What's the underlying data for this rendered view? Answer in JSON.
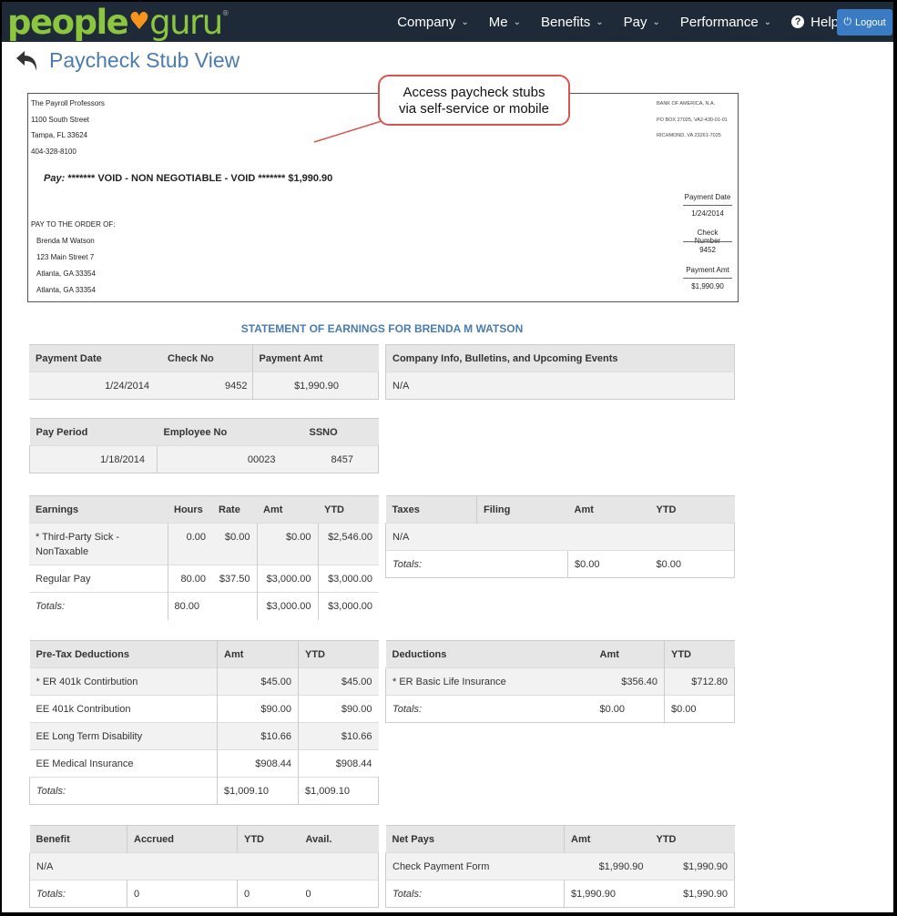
{
  "nav": {
    "logo_people": "people",
    "logo_guru": "guru",
    "items": [
      {
        "label": "Company",
        "chev": "⌄"
      },
      {
        "label": "Me",
        "chev": "⌄"
      },
      {
        "label": "Benefits",
        "chev": "⌄"
      },
      {
        "label": "Pay",
        "chev": "⌄"
      },
      {
        "label": "Performance",
        "chev": "⌄"
      }
    ],
    "help": "Help",
    "logout": "Logout"
  },
  "page": {
    "title": "Paycheck Stub View"
  },
  "callout": {
    "line1": "Access paycheck stubs",
    "line2": "via self-service or mobile"
  },
  "check": {
    "company": [
      "The Payroll Professors",
      "1100 South Street",
      "Tampa, FL 33624",
      "404-328-8100"
    ],
    "bank": [
      "BANK OF AMERICA, N.A.",
      "PO BOX 27025, VA2-430-01-01",
      "RICHMOND, VA 23261-7025"
    ],
    "pay_label": "Pay:",
    "pay_text": "******* VOID - NON NEGOTIABLE - VOID ******* $1,990.90",
    "payment_date_label": "Payment Date",
    "payment_date": "1/24/2014",
    "check_number_label": "Check Number",
    "check_number": "9452",
    "payment_amt_label": "Payment Amt",
    "payment_amt": "$1,990.90",
    "pay_to": "PAY TO THE ORDER OF:",
    "payee": [
      "Brenda M Watson",
      "123 Main Street 7",
      "Atlanta, GA 33354",
      "Atlanta, GA 33354"
    ]
  },
  "statement_title": "STATEMENT OF EARNINGS FOR BRENDA M WATSON",
  "payment": {
    "h": [
      "Payment Date",
      "Check No",
      "Payment Amt"
    ],
    "row": [
      "1/24/2014",
      "9452",
      "$1,990.90"
    ]
  },
  "company_info": {
    "h": "Company Info, Bulletins, and Upcoming Events",
    "v": "N/A"
  },
  "period": {
    "h": [
      "Pay Period",
      "Employee No",
      "SSNO"
    ],
    "row": [
      "1/18/2014",
      "00023",
      "8457"
    ]
  },
  "earnings": {
    "h": [
      "Earnings",
      "Hours",
      "Rate",
      "Amt",
      "YTD"
    ],
    "rows": [
      [
        "* Third-Party Sick -",
        "NonTaxable",
        "0.00",
        "$0.00",
        "$0.00",
        "$2,546.00"
      ],
      [
        "Regular Pay",
        "",
        "80.00",
        "$37.50",
        "$3,000.00",
        "$3,000.00"
      ]
    ],
    "totals": [
      "Totals:",
      "80.00",
      "",
      "$3,000.00",
      "$3,000.00"
    ]
  },
  "taxes": {
    "h": [
      "Taxes",
      "Filing",
      "Amt",
      "YTD"
    ],
    "row": "N/A",
    "totals": [
      "Totals:",
      "$0.00",
      "$0.00"
    ]
  },
  "pretax": {
    "h": [
      "Pre-Tax Deductions",
      "Amt",
      "YTD"
    ],
    "rows": [
      [
        "* ER 401k Contirbution",
        "$45.00",
        "$45.00"
      ],
      [
        "EE 401k Contribution",
        "$90.00",
        "$90.00"
      ],
      [
        "EE Long Term Disability",
        "$10.66",
        "$10.66"
      ],
      [
        "EE Medical Insurance",
        "$908.44",
        "$908.44"
      ]
    ],
    "totals": [
      "Totals:",
      "$1,009.10",
      "$1,009.10"
    ]
  },
  "deductions": {
    "h": [
      "Deductions",
      "Amt",
      "YTD"
    ],
    "rows": [
      [
        "* ER Basic Life Insurance",
        "$356.40",
        "$712.80"
      ]
    ],
    "totals": [
      "Totals:",
      "$0.00",
      "$0.00"
    ]
  },
  "benefit": {
    "h": [
      "Benefit",
      "Accrued",
      "YTD",
      "Avail."
    ],
    "row": "N/A",
    "totals": [
      "Totals:",
      "0",
      "0",
      "0"
    ]
  },
  "netpays": {
    "h": [
      "Net Pays",
      "Amt",
      "YTD"
    ],
    "rows": [
      [
        "Check Payment Form",
        "$1,990.90",
        "$1,990.90"
      ]
    ],
    "totals": [
      "Totals:",
      "$1,990.90",
      "$1,990.90"
    ]
  }
}
